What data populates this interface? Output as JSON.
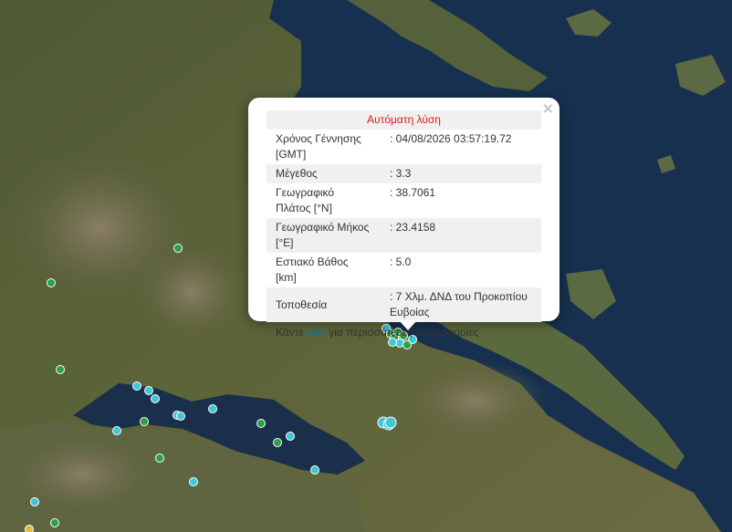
{
  "popup": {
    "close_glyph": "×",
    "title": "Αυτόματη λύση",
    "rows": [
      {
        "label": "Χρόνος Γέννησης [GMT]",
        "value": ": 04/08/2026 03:57:19.72"
      },
      {
        "label": "Μέγεθος",
        "value": ": 3.3"
      },
      {
        "label": "Γεωγραφικό Πλάτος [°N]",
        "value": ": 38.7061"
      },
      {
        "label": "Γεωγραφικό Μήκος [°E]",
        "value": ": 23.4158"
      },
      {
        "label": "Εστιακό Βάθος [km]",
        "value": ": 5.0"
      },
      {
        "label": "Τοποθεσία",
        "value": ": 7 Χλμ. ΔΝΔ του Προκοπίου Ευβοίας"
      }
    ],
    "footer_prefix": "Κάντε",
    "footer_link": "κλικ",
    "footer_suffix": "για περισσότερες πληροφορίες"
  },
  "colors": {
    "title_red": "#e0191c",
    "link_blue": "#0078a8",
    "marker_cyan": "#3fc7d6",
    "marker_green": "#2e9e48"
  }
}
